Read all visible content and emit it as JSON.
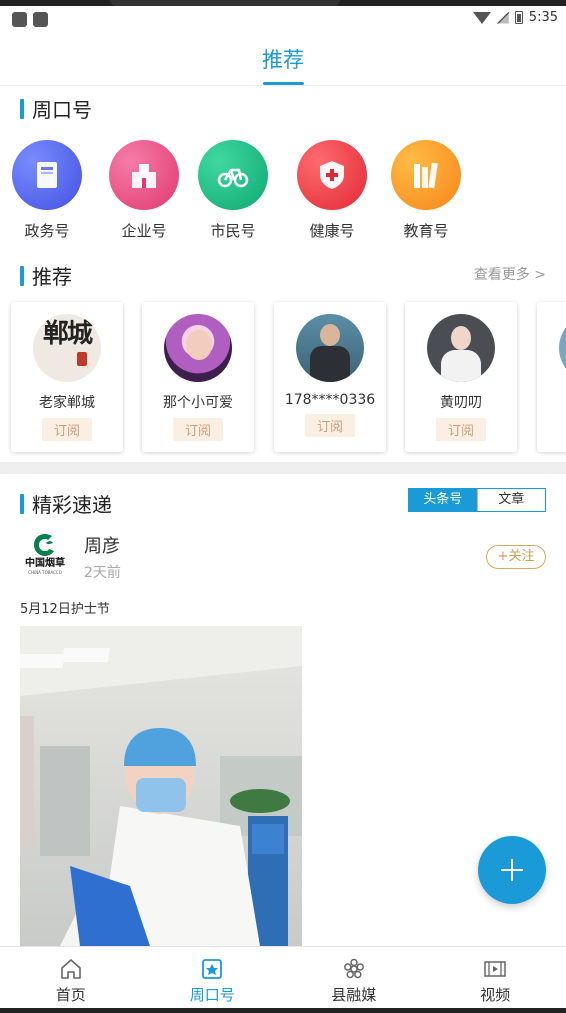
{
  "status_bar": {
    "time": "5:35"
  },
  "top_tab": {
    "label": "推荐"
  },
  "section_zhoukou": {
    "title": "周口号"
  },
  "categories": [
    {
      "label": "政务号",
      "icon": "book-icon",
      "color": "#5b6cf0"
    },
    {
      "label": "企业号",
      "icon": "building-icon",
      "color": "#ea4f87"
    },
    {
      "label": "市民号",
      "icon": "bicycle-icon",
      "color": "#19c083"
    },
    {
      "label": "健康号",
      "icon": "shield-cross-icon",
      "color": "#ef3d48"
    },
    {
      "label": "教育号",
      "icon": "books-icon",
      "color": "#fb9a25"
    }
  ],
  "section_recommend": {
    "title": "推荐",
    "more": "查看更多 >"
  },
  "recommend_cards": [
    {
      "name": "老家郸城",
      "subscribe": "订阅",
      "avatar_text": "郸城"
    },
    {
      "name": "那个小可爱",
      "subscribe": "订阅"
    },
    {
      "name": "178****0336",
      "subscribe": "订阅"
    },
    {
      "name": "黄叨叨",
      "subscribe": "订阅"
    }
  ],
  "section_express": {
    "title": "精彩速递"
  },
  "segment": {
    "left": "头条号",
    "right": "文章"
  },
  "post": {
    "logo_text": "中国烟草",
    "logo_sub": "CHINA TOBACCO",
    "author": "周彦",
    "time": "2天前",
    "follow": "+关注",
    "title": "5月12日护士节"
  },
  "bottom_nav": [
    {
      "label": "首页",
      "icon": "home-icon"
    },
    {
      "label": "周口号",
      "icon": "badge-icon",
      "active": true
    },
    {
      "label": "县融媒",
      "icon": "flower-icon"
    },
    {
      "label": "视频",
      "icon": "film-icon"
    }
  ]
}
